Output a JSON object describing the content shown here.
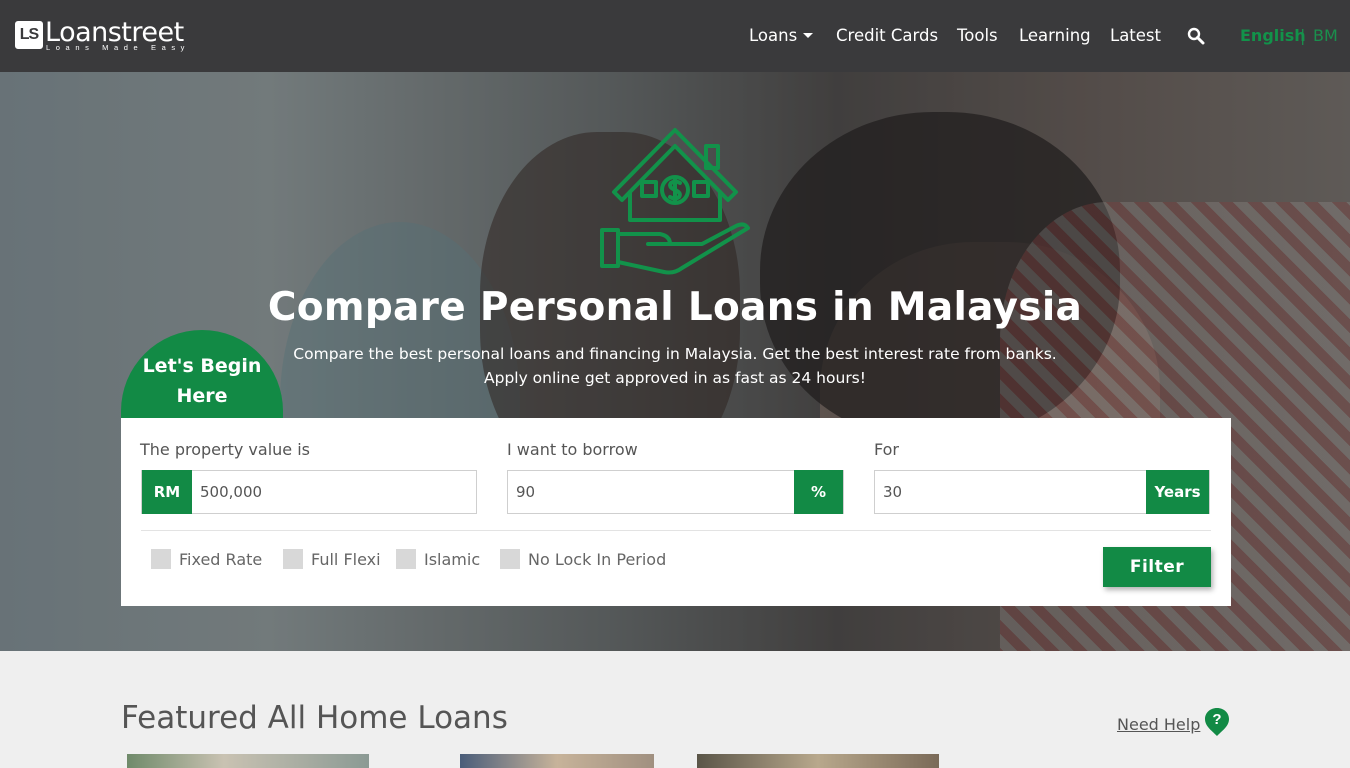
{
  "navbar": {
    "logo_mark": "LS",
    "logo_text": "Loanstreet",
    "logo_tagline": "Loans Made Easy",
    "links": [
      "Loans",
      "Credit Cards",
      "Tools",
      "Learning",
      "Latest"
    ],
    "search_icon": "search-icon",
    "lang_english": "English",
    "lang_sep": "|",
    "lang_bm": "BM"
  },
  "hero": {
    "icon": "house-hand-icon",
    "title": "Compare Personal Loans in Malaysia",
    "subtitle_line1": "Compare the best personal loans and financing in Malaysia. Get the best interest rate from banks.",
    "subtitle_line2": "Apply online get approved in as fast as 24 hours!"
  },
  "begin_badge": {
    "line1": "Let's Begin",
    "line2": "Here"
  },
  "form": {
    "property_label": "The property value is",
    "property_prefix": "RM",
    "property_value": "500,000",
    "borrow_label": "I want to borrow",
    "borrow_value": "90",
    "borrow_suffix": "%",
    "for_label": "For",
    "years_value": "30",
    "years_suffix": "Years",
    "options": [
      "Fixed Rate",
      "Full Flexi",
      "Islamic",
      "No Lock In Period"
    ],
    "filter_label": "Filter"
  },
  "featured": {
    "title": "Featured All Home Loans",
    "help_label": "Need Help",
    "help_icon": "question-pin-icon"
  },
  "colors": {
    "brand_green": "#128a45",
    "navbar_bg": "#3a3a3c"
  }
}
